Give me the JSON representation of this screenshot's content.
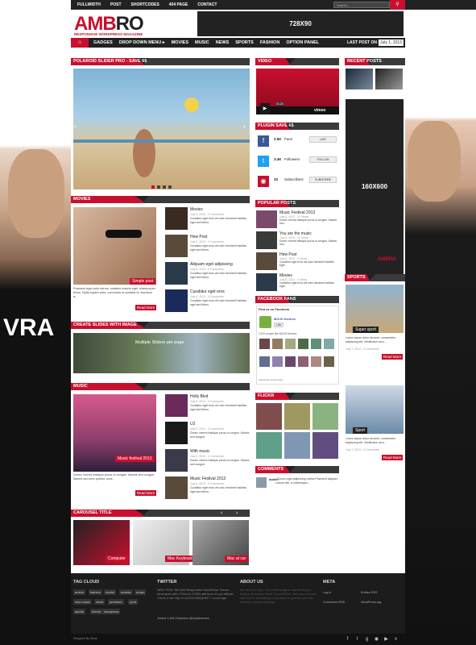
{
  "topnav": [
    "FULLWIDTH",
    "POST",
    "SHORTCODES",
    "404 PAGE",
    "CONTACT"
  ],
  "search_placeholder": "Search...",
  "logo": {
    "amb": "AMB",
    "ro": "RO",
    "tagline": "RESPONSIVE WORDPRESS MAGAZINE"
  },
  "ad_top": "728X90",
  "menu": [
    "GADGES",
    "DROP DOWN MENU ▸",
    "MOVIES",
    "MUSIC",
    "NEWS",
    "SPORTS",
    "FASHION",
    "OPTION PANEL"
  ],
  "last_post_label": "LAST POST ON :",
  "last_post_date": "July 1, 2013",
  "slider_title": "POLAROID SLIDER PRO - SAVE 6$",
  "movies": {
    "title": "MOVIES",
    "featured_caption": "Simple post",
    "featured_text": "Praesent eget,odio rutrum, sodales mauris eget, ullamcorper tellus. Nulla sapien ante, commodo et sodales id, faucibus a...",
    "read_more": "Read More",
    "list": [
      {
        "title": "Movies",
        "meta": "July 6, 2013 - 0 Comments",
        "text": "Curabitur eget eros vel odio hendrerit facilisis eget sed libero."
      },
      {
        "title": "Hew Post",
        "meta": "July 6, 2013 - 0 Comments",
        "text": "Curabitur eget eros vel odio hendrerit facilisis eget sed libero."
      },
      {
        "title": "Aliquam eget adipiscing",
        "meta": "July 6, 2013 - 0 Comments",
        "text": "Curabitur eget eros vel odio hendrerit facilisis eget sed libero."
      },
      {
        "title": "Curabitur eget eros",
        "meta": "July 6, 2013 - 0 Comments",
        "text": "Curabitur eget eros vel odio hendrerit facilisis eget sed libero."
      }
    ]
  },
  "sliders_title": "CREATE SLIDES WITH IMAGE",
  "sliders_caption": "Multiple Sliders per page",
  "music": {
    "title": "MUSIC",
    "featured_caption": "Music festival 2013",
    "featured_text": "Donec viverra tristique purus ut congue. Mauris sed congue. Mauris sed sem portitor urna...",
    "read_more": "Read More",
    "list": [
      {
        "title": "Holly Blvd",
        "meta": "July 6, 2013 - 0 Comments",
        "text": "Curabitur eget eros vel odio hendrerit facilisis eget sed libero."
      },
      {
        "title": "U2",
        "meta": "July 6, 2013 - 0 Comments",
        "text": "Donec viverra tristique purus ut congue. Mauris sed congue."
      },
      {
        "title": "With music",
        "meta": "July 6, 2013 - 0 Comments",
        "text": "Donec viverra tristique purus ut congue. Mauris sed congue."
      },
      {
        "title": "Music Festival 2013",
        "meta": "July 6, 2013 - 0 Comments",
        "text": "Curabitur eget eros vel odio hendrerit facilisis eget sed libero."
      }
    ]
  },
  "carousel": {
    "title": "CAROUSEL TITLE",
    "items": [
      "Computer",
      "Mac Keyboad",
      "Mac at car"
    ]
  },
  "video": {
    "title": "VIDEO",
    "time": "01:24",
    "brand": "vimeo"
  },
  "plugin": {
    "title": "PLUGIN SAVE 6$",
    "rows": [
      {
        "count": "2.5K",
        "label": "Fans",
        "btn": "LIKE"
      },
      {
        "count": "3.4K",
        "label": "Followers",
        "btn": "FOLLOW"
      },
      {
        "count": "33",
        "label": "Subscribers",
        "btn": "SUBSCRIBE"
      }
    ]
  },
  "popular": {
    "title": "POPULAR POSTS",
    "list": [
      {
        "title": "Music Festival 2013",
        "meta": "July 6, 2013 - 12 Views",
        "text": "Donec viverra tristique purus ut congue. Mauris sed."
      },
      {
        "title": "You are the music",
        "meta": "July 6, 2013 - 13 Views",
        "text": "Donec viverra tristique purus ut congue. Mauris sed."
      },
      {
        "title": "Hew Post",
        "meta": "July 6, 2013 - 0 Views",
        "text": "Curabitur eget eros vel odio hendrerit facilisis eget."
      },
      {
        "title": "Movies",
        "meta": "July 6, 2013 - 0 Views",
        "text": "Curabitur eget eros vel odio hendrerit facilisis eget."
      }
    ]
  },
  "facebook": {
    "title": "FACEBOOK FANS",
    "find": "Find us on Facebook",
    "page": "MOJO themes",
    "like": "Like",
    "count": "2,572 people like MOJO themes.",
    "plugin": "Facebook social plugin"
  },
  "flickr": {
    "title": "FLICKR"
  },
  "comments": {
    "title": "COMMENTS",
    "author": "admin",
    "text": "• Donec eget adipiscing metus Praesent aliquam cursus nisl, a scelerisque..."
  },
  "recent": {
    "title": "RECENT POSTS"
  },
  "ad_side": "160X600",
  "ad_side_brand": "AMBRO",
  "sports": {
    "title": "SPORTS",
    "items": [
      {
        "caption": "Super sport",
        "text": "Lorem ipsum dolor sit amet, consectetur adipiscing elit. Vestibulum arcu...",
        "meta": "July 7, 2013 - 0 Comments",
        "btn": "Read More"
      },
      {
        "caption": "Sport",
        "text": "Lorem ipsum dolor sit amet, consectetur adipiscing elit. Vestibulum arcu...",
        "meta": "July 7, 2013 - 0 Comments",
        "btn": "Read More"
      }
    ]
  },
  "footer": {
    "tagcloud_title": "TAG CLOUD",
    "tags": [
      "ambro",
      "fashion",
      "model",
      "movies",
      "music",
      "new music",
      "news",
      "premium",
      "rport",
      "sports",
      "theme",
      "wordpress"
    ],
    "twitter_title": "TWITTER",
    "tweet": "NEW ITEM: SW Well Responsive WordPress Theme - developed with HTML5 & CSS3 with tons of cool effects! Check it out: http://t.co/XOXO8hQHM7 7 hours ago",
    "tweet_meta": "Joined 1,465 Followers @mojothemes",
    "about_title": "ABOUT US",
    "about_text": "My name is Sony. I'm a web designer and developer living in Romania. Need ThemeREW? Just save contact with me for something or purchase a question you can send me private message.",
    "meta_title": "META",
    "meta_links": [
      "Log in",
      "Entries RSS",
      "Comments RSS",
      "WordPress.org"
    ],
    "designed_by": "Designed By Siene"
  },
  "colors": {
    "accent": "#c8102e",
    "dark": "#222222"
  }
}
